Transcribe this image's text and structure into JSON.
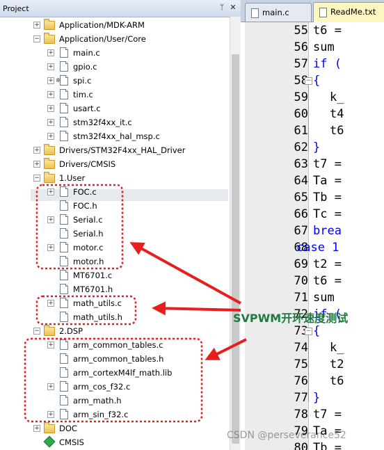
{
  "project_pane": {
    "title": "Project",
    "pin_icon": "pin-icon",
    "close_icon": "close-icon",
    "tree": [
      {
        "label": "Application/MDK-ARM",
        "type": "folder",
        "expander": "+"
      },
      {
        "label": "Application/User/Core",
        "type": "folder",
        "expander": "−"
      },
      {
        "label": "main.c",
        "type": "file",
        "expander": "+"
      },
      {
        "label": "gpio.c",
        "type": "file",
        "expander": "+"
      },
      {
        "label": "spi.c",
        "type": "file",
        "expander": "+",
        "lock": true
      },
      {
        "label": "tim.c",
        "type": "file",
        "expander": "+"
      },
      {
        "label": "usart.c",
        "type": "file",
        "expander": "+"
      },
      {
        "label": "stm32f4xx_it.c",
        "type": "file",
        "expander": "+"
      },
      {
        "label": "stm32f4xx_hal_msp.c",
        "type": "file",
        "expander": "+"
      },
      {
        "label": "Drivers/STM32F4xx_HAL_Driver",
        "type": "folder",
        "expander": "+"
      },
      {
        "label": "Drivers/CMSIS",
        "type": "folder",
        "expander": "+"
      },
      {
        "label": "1.User",
        "type": "folder",
        "expander": "−"
      },
      {
        "label": "FOC.c",
        "type": "file",
        "expander": "+"
      },
      {
        "label": "FOC.h",
        "type": "file",
        "expander": ""
      },
      {
        "label": "Serial.c",
        "type": "file",
        "expander": "+"
      },
      {
        "label": "Serial.h",
        "type": "file",
        "expander": ""
      },
      {
        "label": "motor.c",
        "type": "file",
        "expander": "+"
      },
      {
        "label": "motor.h",
        "type": "file",
        "expander": ""
      },
      {
        "label": "MT6701.c",
        "type": "file",
        "expander": ""
      },
      {
        "label": "MT6701.h",
        "type": "file",
        "expander": ""
      },
      {
        "label": "math_utils.c",
        "type": "file",
        "expander": "+"
      },
      {
        "label": "math_utils.h",
        "type": "file",
        "expander": ""
      },
      {
        "label": "2.DSP",
        "type": "folder",
        "expander": "−"
      },
      {
        "label": "arm_common_tables.c",
        "type": "file",
        "expander": "+"
      },
      {
        "label": "arm_common_tables.h",
        "type": "file",
        "expander": ""
      },
      {
        "label": "arm_cortexM4lf_math.lib",
        "type": "file",
        "expander": ""
      },
      {
        "label": "arm_cos_f32.c",
        "type": "file",
        "expander": "+"
      },
      {
        "label": "arm_math.h",
        "type": "file",
        "expander": ""
      },
      {
        "label": "arm_sin_f32.c",
        "type": "file",
        "expander": "+"
      },
      {
        "label": "DOC",
        "type": "folder",
        "expander": "+"
      },
      {
        "label": "CMSIS",
        "type": "cmsis",
        "expander": ""
      }
    ]
  },
  "editor": {
    "tabs": [
      {
        "label": "main.c",
        "active": false
      },
      {
        "label": "ReadMe.txt",
        "active": true
      }
    ],
    "lines": [
      {
        "num": "55",
        "code": "t6 ="
      },
      {
        "num": "56",
        "code": "sum "
      },
      {
        "num": "57",
        "code": "if ("
      },
      {
        "num": "58",
        "code": "{"
      },
      {
        "num": "59",
        "code": "k_"
      },
      {
        "num": "60",
        "code": "t4"
      },
      {
        "num": "61",
        "code": "t6"
      },
      {
        "num": "62",
        "code": "}"
      },
      {
        "num": "63",
        "code": "t7 ="
      },
      {
        "num": "64",
        "code": "Ta ="
      },
      {
        "num": "65",
        "code": "Tb ="
      },
      {
        "num": "66",
        "code": "Tc ="
      },
      {
        "num": "67",
        "code": "brea"
      },
      {
        "num": "68",
        "code": "case 1"
      },
      {
        "num": "69",
        "code": "t2 ="
      },
      {
        "num": "70",
        "code": "t6 ="
      },
      {
        "num": "71",
        "code": "sum "
      },
      {
        "num": "72",
        "code": "if ("
      },
      {
        "num": "73",
        "code": "{"
      },
      {
        "num": "74",
        "code": "k_"
      },
      {
        "num": "75",
        "code": "t2"
      },
      {
        "num": "76",
        "code": "t6"
      },
      {
        "num": "77",
        "code": "}"
      },
      {
        "num": "78",
        "code": "t7 ="
      },
      {
        "num": "79",
        "code": "Ta ="
      },
      {
        "num": "80",
        "code": "Tb ="
      }
    ]
  },
  "annotation": {
    "text": "SVPWM开环速度测试",
    "highlight_color": "#e81e1e",
    "text_color": "#1f7a3f"
  },
  "watermark": "CSDN @perseverance52"
}
